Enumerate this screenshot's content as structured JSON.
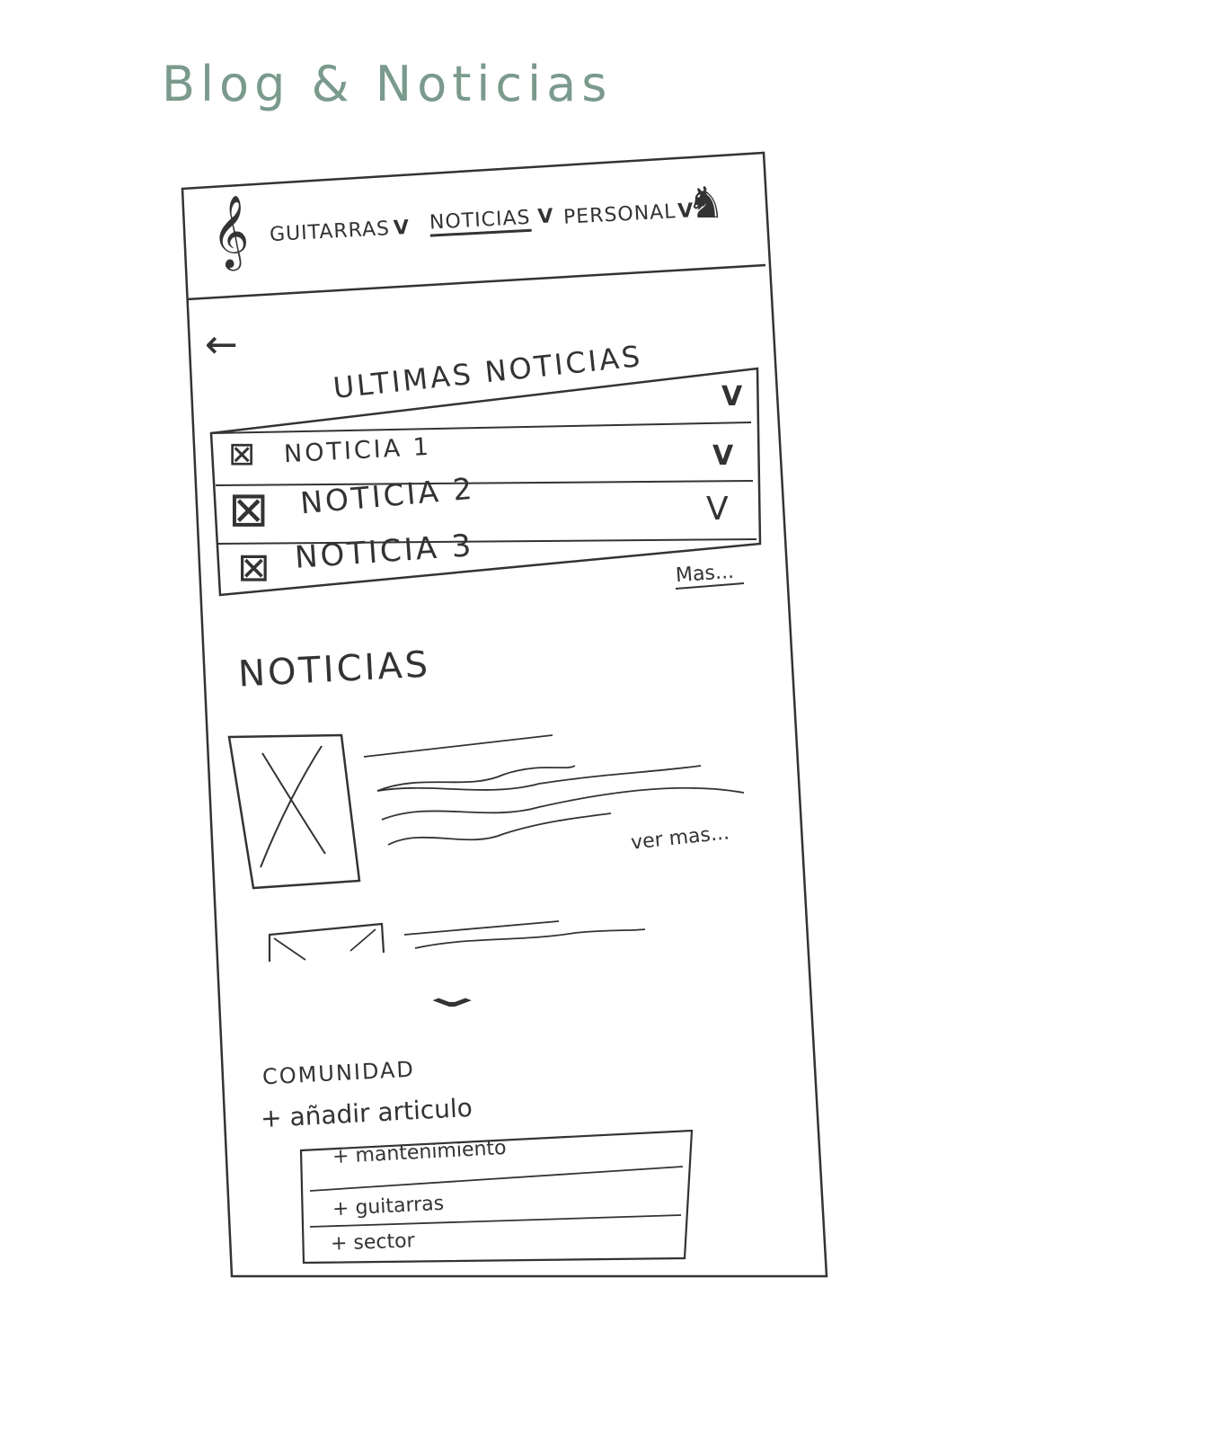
{
  "page_title": "Blog & Noticias",
  "nav": {
    "items": [
      {
        "label": "GUITARRAS",
        "chevron": "V"
      },
      {
        "label": "NOTICIAS",
        "chevron": "V"
      },
      {
        "label": "PERSONAL",
        "chevron": "V"
      }
    ]
  },
  "latest": {
    "title": "ULTIMAS NOTICIAS",
    "items": [
      {
        "label": "NOTICIA 1"
      },
      {
        "label": "NOTICIA 2"
      },
      {
        "label": "NOTICIA 3"
      }
    ],
    "more_label": "Mas..."
  },
  "news": {
    "title": "NOTICIAS",
    "see_more_label": "ver mas..."
  },
  "community": {
    "title": "COMUNIDAD",
    "add_article_label": "+ añadir articulo",
    "options": [
      {
        "label": "+ mantenimiento"
      },
      {
        "label": "+ guitarras"
      },
      {
        "label": "+ sector"
      }
    ]
  },
  "icons": {
    "logo": "treble-clef-icon",
    "user": "user-icon",
    "back": "back-arrow-icon",
    "expand": "chevron-down-icon",
    "image": "image-placeholder-icon"
  },
  "colors": {
    "title": "#7a9a8c",
    "ink": "#333333"
  }
}
